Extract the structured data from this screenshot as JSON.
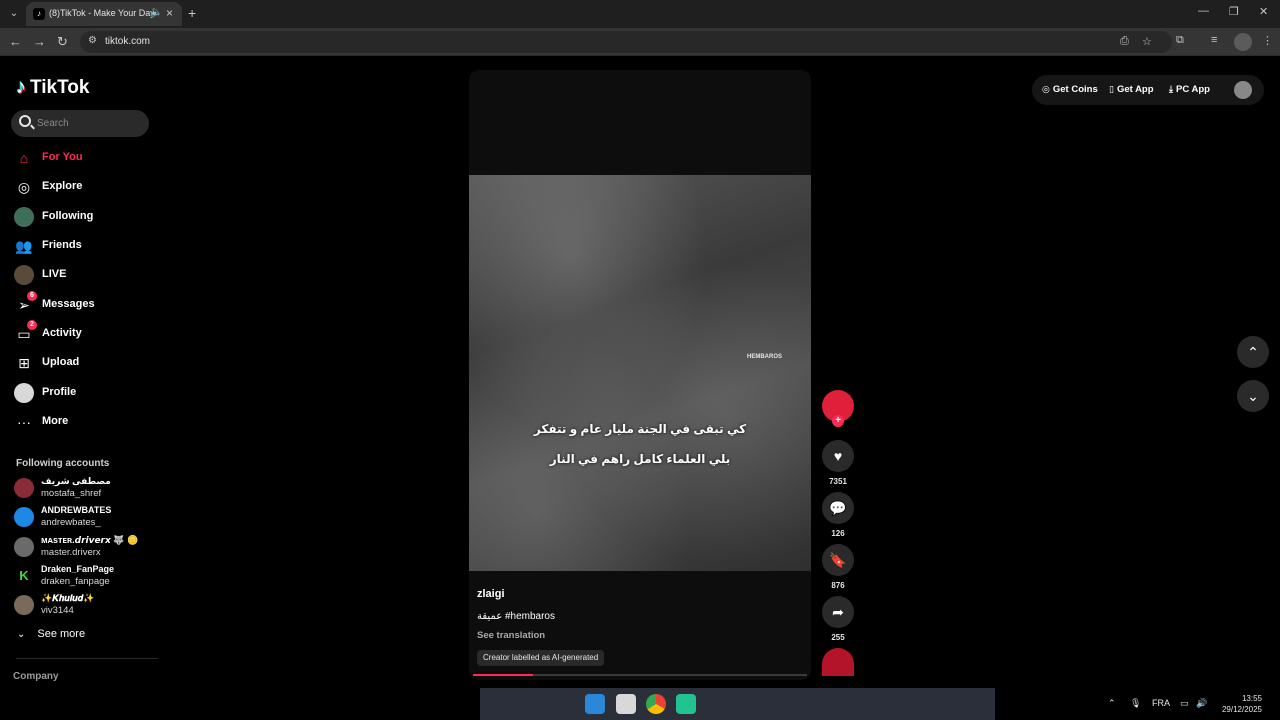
{
  "browser": {
    "tab_title": "(8)TikTok - Make Your Day",
    "url": "tiktok.com"
  },
  "logo": "TikTok",
  "search": {
    "placeholder": "Search"
  },
  "nav": [
    {
      "label": "For You",
      "icon": "home-icon"
    },
    {
      "label": "Explore",
      "icon": "compass-icon"
    },
    {
      "label": "Following",
      "icon": "avatar"
    },
    {
      "label": "Friends",
      "icon": "friends-icon"
    },
    {
      "label": "LIVE",
      "icon": "avatar"
    },
    {
      "label": "Messages",
      "icon": "send-icon",
      "badge": "6"
    },
    {
      "label": "Activity",
      "icon": "activity-icon",
      "badge": "2"
    },
    {
      "label": "Upload",
      "icon": "plus-square-icon"
    },
    {
      "label": "Profile",
      "icon": "avatar"
    },
    {
      "label": "More",
      "icon": "more-icon"
    }
  ],
  "following": {
    "title": "Following accounts",
    "accounts": [
      {
        "name": "مصطفى شريف",
        "handle": "mostafa_shref",
        "color": "#8a2b3a"
      },
      {
        "name": "ANDREWBATES",
        "handle": "andrewbates_",
        "color": "#1e88e5"
      },
      {
        "name": "ᴍᴀsᴛᴇʀ.𝙙𝙧𝙞𝙫𝙚𝙧𝙭 🐺 🪙",
        "handle": "master.driverx",
        "color": "#6a6a6a"
      },
      {
        "name": "Draken_FanPage",
        "handle": "draken_fanpage",
        "color": "#000000"
      },
      {
        "name": "✨𝑲𝒉𝒖𝒍𝒖𝒅✨",
        "handle": "viv3144",
        "color": "#7a6a5a"
      }
    ],
    "see_more": "See more"
  },
  "company": "Company",
  "top_actions": {
    "coins": "Get Coins",
    "app": "Get App",
    "pc": "PC App"
  },
  "video": {
    "watermark": "HEMBAROS",
    "overlay_line1": "كي تبقى في الجنة مليار عام و تتفكر",
    "overlay_line2": "بلي العلماء كامل راهم في النار",
    "author": "zlaigi",
    "caption": "عميقة #hembaros",
    "see_translation": "See translation",
    "ai_label": "Creator labelled as AI-generated",
    "progress": 0.18
  },
  "actions": {
    "likes": "7351",
    "comments": "126",
    "saves": "876",
    "shares": "255"
  },
  "system": {
    "language": "FRA",
    "time": "13:55",
    "date": "29/12/2025"
  },
  "colors": {
    "accent": "#fe2c55",
    "background": "#000000"
  }
}
